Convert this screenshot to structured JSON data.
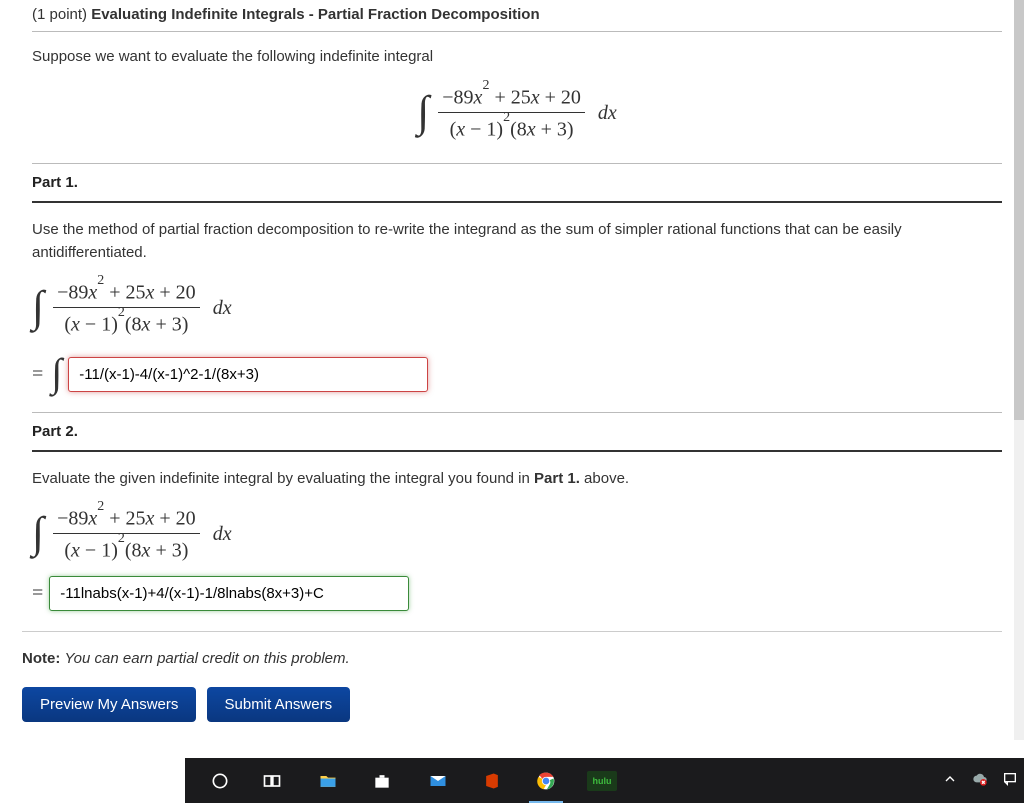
{
  "header": {
    "points_prefix": "(1 point) ",
    "title": "Evaluating Indefinite Integrals - Partial Fraction Decomposition"
  },
  "intro_text": "Suppose we want to evaluate the following indefinite integral",
  "integral": {
    "numerator_minus": "−89",
    "numerator_rest": " + 25",
    "numerator_tail": " + 20",
    "denom_a": "(",
    "denom_b": " − 1)",
    "denom_c": "(8",
    "denom_d": " + 3)",
    "dx": "dx"
  },
  "part1": {
    "label": "Part 1.",
    "body": "Use the method of partial fraction decomposition to re-write the integrand as the sum of simpler rational functions that can be easily antidifferentiated.",
    "answer_value": "-11/(x-1)-4/(x-1)^2-1/(8x+3)"
  },
  "part2": {
    "label": "Part 2.",
    "body_pre": "Evaluate the given indefinite integral by evaluating the integral you found in ",
    "body_bold": "Part 1.",
    "body_post": " above.",
    "answer_value": "-11lnabs(x-1)+4/(x-1)-1/8lnabs(8x+3)+C"
  },
  "note": {
    "label": "Note: ",
    "text": "You can earn partial credit on this problem."
  },
  "buttons": {
    "preview": "Preview My Answers",
    "submit": "Submit Answers"
  },
  "taskbar": {
    "hulu": "hulu"
  },
  "math_vars": {
    "x": "x",
    "sq": "2",
    "eq": "="
  }
}
